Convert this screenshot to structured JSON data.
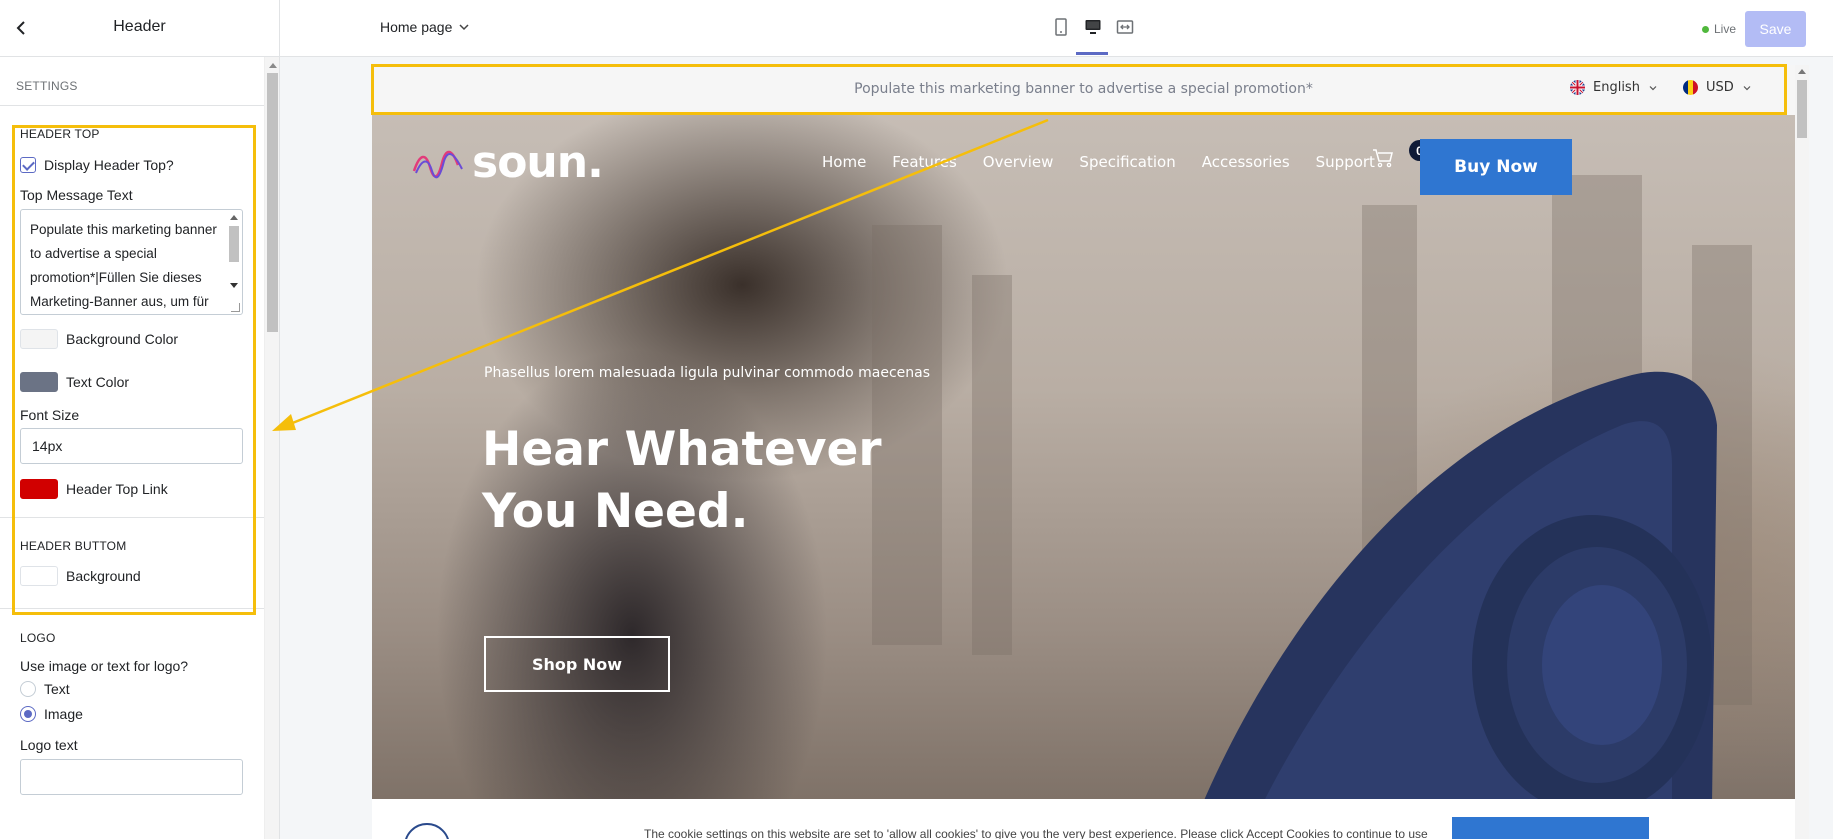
{
  "sidebar": {
    "title": "Header",
    "settings_label": "SETTINGS",
    "header_top": {
      "label": "HEADER TOP",
      "display_label": "Display Header Top?",
      "top_message_label": "Top Message Text",
      "top_message_value": "Populate this marketing banner to advertise a special promotion*|Füllen Sie dieses Marketing-Banner aus, um für",
      "background_color_label": "Background Color",
      "background_color": "#f4f4f4",
      "text_color_label": "Text Color",
      "text_color": "#6b7385",
      "font_size_label": "Font Size",
      "font_size_value": "14px",
      "header_top_link_label": "Header Top Link",
      "header_top_link_color": "#d10000"
    },
    "header_bottom": {
      "label": "HEADER BUTTOM",
      "background_label": "Background",
      "background_color": "#ffffff"
    },
    "logo": {
      "label": "LOGO",
      "question": "Use image or text for logo?",
      "option_text": "Text",
      "option_image": "Image",
      "logo_text_label": "Logo text",
      "logo_text_value": ""
    }
  },
  "topbar": {
    "page_select": "Home page",
    "live_label": "Live",
    "save_label": "Save"
  },
  "preview": {
    "promo_text": "Populate this marketing banner to advertise a special promotion*",
    "language": "English",
    "currency": "USD",
    "logo_text": "soun.",
    "nav": [
      "Home",
      "Features",
      "Overview",
      "Specification",
      "Accessories",
      "Support"
    ],
    "cart_count": "0",
    "buy_now": "Buy Now",
    "kicker": "Phasellus lorem malesuada ligula pulvinar commodo maecenas",
    "headline_1": "Hear Whatever",
    "headline_2": "You Need.",
    "shop_now": "Shop Now",
    "cookie_text": "The cookie settings on this website are set to 'allow all cookies' to give you the very best experience. Please click Accept Cookies to continue to use"
  },
  "colors": {
    "accent": "#5c6ac4",
    "highlight": "#f5be0b",
    "buy_button": "#2f76d1"
  }
}
